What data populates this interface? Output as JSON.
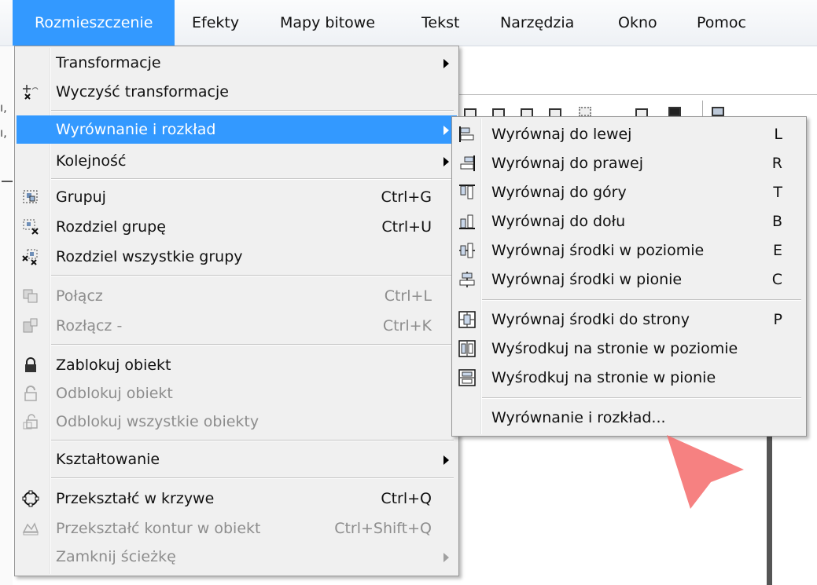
{
  "menubar": {
    "items": [
      {
        "label": "Rozmieszczenie",
        "underline": "R",
        "rest": "ozmieszczenie",
        "active": true
      },
      {
        "label": "Efekty"
      },
      {
        "label": "Mapy bitowe"
      },
      {
        "label": "Tekst"
      },
      {
        "label": "Narzędzia"
      },
      {
        "label": "Okno"
      },
      {
        "label": "Pomoc"
      }
    ]
  },
  "main_menu": {
    "items": [
      {
        "label": "Transformacje",
        "submenu": true
      },
      {
        "label": "Wyczyść transformacje",
        "icon": "clear-transform-icon"
      },
      {
        "label": "Wyrównanie i rozkład",
        "submenu": true,
        "highlighted": true
      },
      {
        "label": "Kolejność",
        "submenu": true
      },
      {
        "label": "Grupuj",
        "shortcut": "Ctrl+G",
        "icon": "group-icon"
      },
      {
        "label": "Rozdziel grupę",
        "shortcut": "Ctrl+U",
        "icon": "ungroup-icon"
      },
      {
        "label": "Rozdziel wszystkie grupy",
        "icon": "ungroup-all-icon"
      },
      {
        "label": "Połącz",
        "shortcut": "Ctrl+L",
        "icon": "combine-icon",
        "disabled": true
      },
      {
        "label": "Rozłącz -",
        "shortcut": "Ctrl+K",
        "icon": "break-apart-icon",
        "disabled": true
      },
      {
        "label": "Zablokuj obiekt",
        "icon": "lock-icon"
      },
      {
        "label": "Odblokuj obiekt",
        "icon": "unlock-icon",
        "disabled": true
      },
      {
        "label": "Odblokuj wszystkie obiekty",
        "icon": "unlock-all-icon",
        "disabled": true
      },
      {
        "label": "Kształtowanie",
        "submenu": true
      },
      {
        "label": "Przekształć w krzywe",
        "shortcut": "Ctrl+Q",
        "icon": "convert-to-curves-icon"
      },
      {
        "label": "Przekształć kontur w obiekt",
        "shortcut": "Ctrl+Shift+Q",
        "icon": "outline-to-object-icon",
        "disabled": true
      },
      {
        "label": "Zamknij ścieżkę",
        "submenu": true,
        "disabled": true
      }
    ]
  },
  "sub_menu": {
    "items": [
      {
        "label": "Wyrównaj do lewej",
        "shortcut": "L",
        "icon": "align-left-icon"
      },
      {
        "label": "Wyrównaj do prawej",
        "shortcut": "R",
        "icon": "align-right-icon"
      },
      {
        "label": "Wyrównaj do góry",
        "shortcut": "T",
        "icon": "align-top-icon"
      },
      {
        "label": "Wyrównaj do dołu",
        "shortcut": "B",
        "icon": "align-bottom-icon"
      },
      {
        "label": "Wyrównaj środki w poziomie",
        "shortcut": "E",
        "icon": "align-center-horizontal-icon"
      },
      {
        "label": "Wyrównaj środki w pionie",
        "shortcut": "C",
        "icon": "align-center-vertical-icon"
      },
      {
        "label": "Wyrównaj środki do strony",
        "shortcut": "P",
        "icon": "align-page-center-icon"
      },
      {
        "label": "Wyśrodkuj na stronie w poziomie",
        "shortcut": "",
        "icon": "center-page-horizontal-icon"
      },
      {
        "label": "Wyśrodkuj na stronie w pionie",
        "shortcut": "",
        "icon": "center-page-vertical-icon"
      },
      {
        "label": "Wyrównanie i rozkład...",
        "shortcut": ""
      }
    ]
  },
  "colors": {
    "highlight": "#3399ff",
    "menu_bg": "#f0f0f0",
    "disabled_text": "#8d8d8d",
    "pointer": "#f56b6b"
  }
}
